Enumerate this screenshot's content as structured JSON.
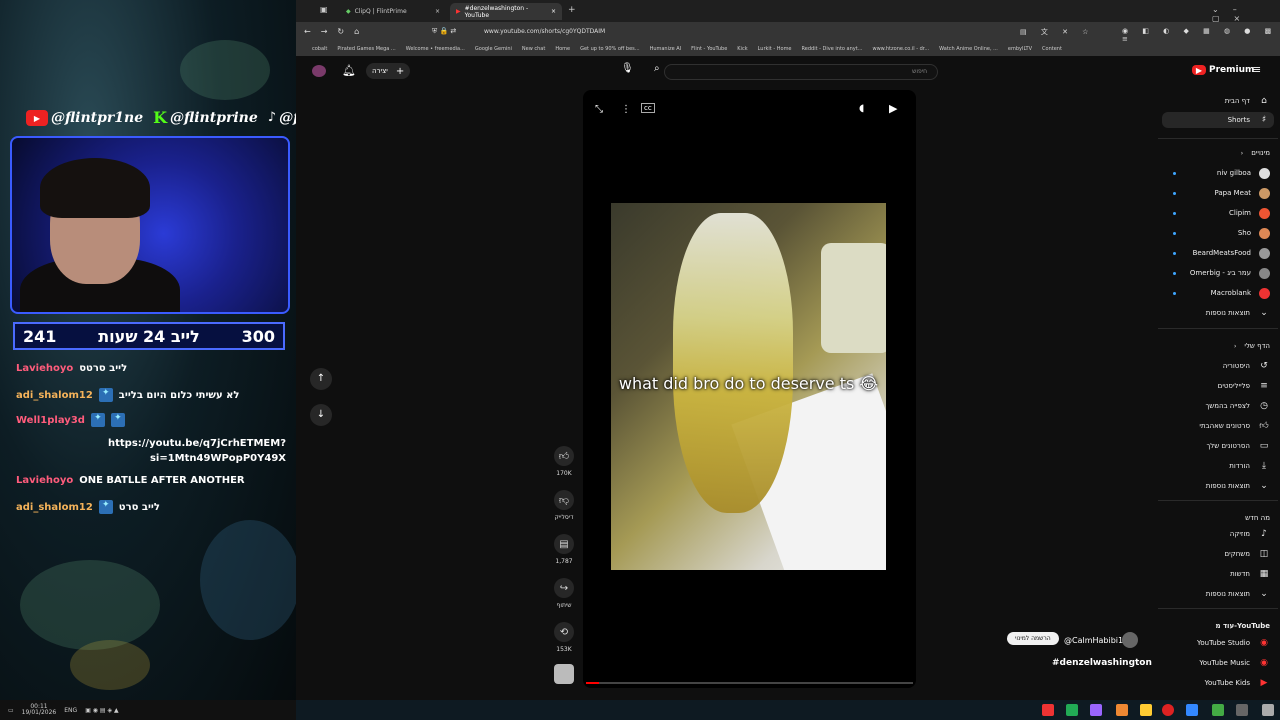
{
  "stream": {
    "social_youtube": "@flintpr1ne",
    "social_kick": "@flintprine",
    "social_tiktok": "@flintprine",
    "counter_left": "241",
    "counter_title": "לייב 24 שעות",
    "counter_right": "300",
    "chat": [
      {
        "user": "Laviehoyo",
        "msg": "לייב סרטס",
        "badges": 0
      },
      {
        "user": "adi_shalom12",
        "msg": "לא עשיתי כלום היום בלייב",
        "badges": 1
      },
      {
        "user": "Well1play3d",
        "msg": "",
        "badges": 2
      },
      {
        "user": "",
        "msg": "https://youtu.be/q7jCrhETMEM?si=1Mtn49WPopP0Y49X",
        "badges": 0
      },
      {
        "user": "Laviehoyo",
        "msg": "ONE BATLLE AFTER ANOTHER",
        "badges": 0
      },
      {
        "user": "adi_shalom12",
        "msg": "לייב סרט",
        "badges": 1
      }
    ],
    "clock_time": "00:11",
    "clock_date": "19/01/2026",
    "lang": "ENG"
  },
  "browser": {
    "tabs": [
      {
        "title": "ClipQ | FlintPrime",
        "active": false
      },
      {
        "title": "#denzelwashington - YouTube",
        "active": true
      }
    ],
    "url": "www.youtube.com/shorts/cg0YQDTDAIM",
    "bookmarks": [
      "cobalt",
      "Pirated Games Mega ...",
      "Welcome • freemedia...",
      "Google Gemini",
      "New chat",
      "Home",
      "Get up to 90% off bes...",
      "Humanize AI",
      "Flint - YouTube",
      "Kick",
      "Lurkit - Home",
      "Reddit - Dive into anyt...",
      "www.htzone.co.il - dr...",
      "Watch Anime Online, ...",
      "embyILTV",
      "Content"
    ]
  },
  "youtube": {
    "create_label": "יצירה",
    "search_placeholder": "חיפוש",
    "logo": "Premium",
    "video_caption": "what did bro do to deserve ts 😂",
    "actions": [
      {
        "icon": "like-icon",
        "label": "170K"
      },
      {
        "icon": "dislike-icon",
        "label": "דיסלייק"
      },
      {
        "icon": "comment-icon",
        "label": "1,787"
      },
      {
        "icon": "share-icon",
        "label": "שיתוף"
      },
      {
        "icon": "remix-icon",
        "label": "153K"
      }
    ],
    "channel": "@CalmHabibi1",
    "subscribe": "הרשמה למינוי",
    "hashtag": "#denzelwashington",
    "sidebar": {
      "home": "דף הבית",
      "shorts": "Shorts",
      "subs_header": "מינויים",
      "subs": [
        "niv gilboa",
        "Papa Meat",
        "Clipim",
        "Sho",
        "BeardMeatsFood",
        "Omerbig - עמר ביג",
        "Macroblank"
      ],
      "show_more": "תוצאות נוספות",
      "you_header": "הדף שלי",
      "you_items": [
        "היסטוריה",
        "פלייליסטים",
        "לצפייה בהמשך",
        "סרטונים שאהבתי",
        "הסרטונים שלך",
        "הורדות"
      ],
      "explore_header": "מה חדש",
      "explore_items": [
        "מוזיקה",
        "משחקים",
        "חדשות"
      ],
      "more_header": "עוד מ-YouTube",
      "more_items": [
        "YouTube Studio",
        "YouTube Music",
        "YouTube Kids"
      ]
    }
  }
}
